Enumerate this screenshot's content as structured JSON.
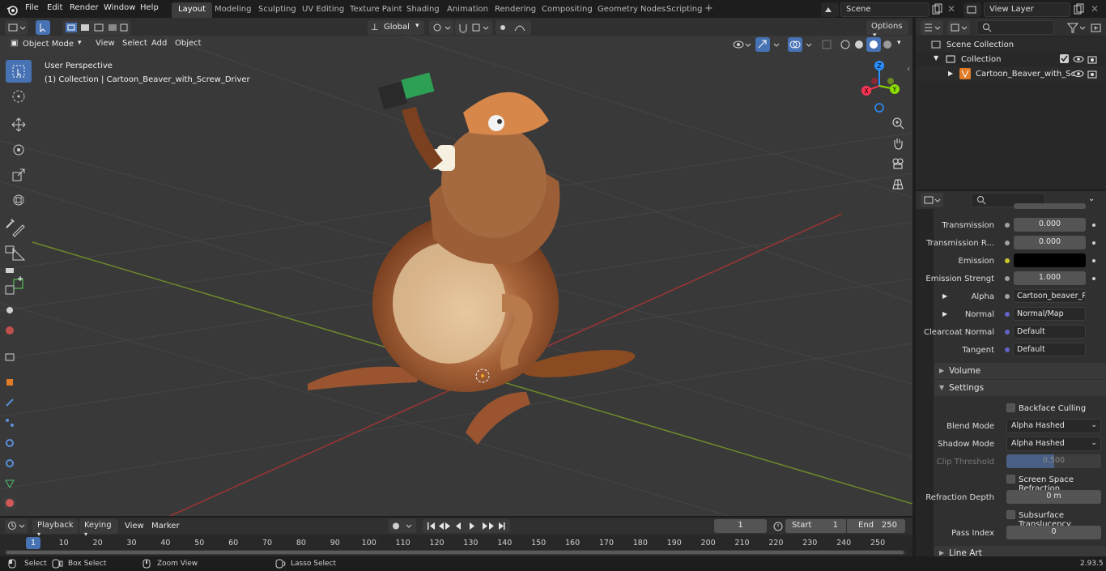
{
  "top_menu": [
    "File",
    "Edit",
    "Render",
    "Window",
    "Help"
  ],
  "workspace_tabs": [
    "Layout",
    "Modeling",
    "Sculpting",
    "UV Editing",
    "Texture Paint",
    "Shading",
    "Animation",
    "Rendering",
    "Compositing",
    "Geometry Nodes",
    "Scripting"
  ],
  "active_workspace": "Layout",
  "scene_name": "Scene",
  "view_layer": "View Layer",
  "viewport": {
    "mode": "Object Mode",
    "menus": [
      "View",
      "Select",
      "Add",
      "Object"
    ],
    "transform_orientation": "Global",
    "options_label": "Options",
    "overlay_title": "User Perspective",
    "overlay_subtitle": "(1) Collection | Cartoon_Beaver_with_Screw_Driver",
    "gizmo": {
      "x": "X",
      "y": "Y",
      "z": "Z"
    }
  },
  "outliner": {
    "scene_collection": "Scene Collection",
    "collection": "Collection",
    "object": "Cartoon_Beaver_with_Sc"
  },
  "properties": {
    "rows": [
      {
        "label": "Transmission",
        "value": "0.000",
        "kind": "slider"
      },
      {
        "label": "Transmission R...",
        "value": "0.000",
        "kind": "slider"
      },
      {
        "label": "Emission",
        "value": "",
        "kind": "color"
      },
      {
        "label": "Emission Strengt",
        "value": "1.000",
        "kind": "slider"
      },
      {
        "label": "Alpha",
        "value": "Cartoon_beaver_Re...",
        "kind": "link"
      },
      {
        "label": "Normal",
        "value": "Normal/Map",
        "kind": "link"
      },
      {
        "label": "Clearcoat Normal",
        "value": "Default",
        "kind": "link"
      },
      {
        "label": "Tangent",
        "value": "Default",
        "kind": "link"
      }
    ],
    "volume_label": "Volume",
    "settings_label": "Settings",
    "backface_culling": "Backface Culling",
    "blend_mode_label": "Blend Mode",
    "blend_mode": "Alpha Hashed",
    "shadow_mode_label": "Shadow Mode",
    "shadow_mode": "Alpha Hashed",
    "clip_threshold_label": "Clip Threshold",
    "clip_threshold": "0.500",
    "ssr_label": "Screen Space Refraction",
    "refraction_depth_label": "Refraction Depth",
    "refraction_depth": "0 m",
    "subsurface_label": "Subsurface Translucency",
    "pass_index_label": "Pass Index",
    "pass_index": "0",
    "line_art_label": "Line Art"
  },
  "timeline": {
    "menus": [
      "Playback",
      "Keying",
      "View",
      "Marker"
    ],
    "current_frame": "1",
    "start_label": "Start",
    "start": "1",
    "end_label": "End",
    "end": "250",
    "ticks": [
      "1",
      "10",
      "20",
      "30",
      "40",
      "50",
      "60",
      "70",
      "80",
      "90",
      "100",
      "110",
      "120",
      "130",
      "140",
      "150",
      "160",
      "170",
      "180",
      "190",
      "200",
      "210",
      "220",
      "230",
      "240",
      "250"
    ]
  },
  "statusbar": {
    "select": "Select",
    "box_select": "Box Select",
    "zoom_view": "Zoom View",
    "lasso_select": "Lasso Select",
    "version": "2.93.5"
  },
  "colors": {
    "accent": "#4772b3",
    "x_axis": "#ff3352",
    "y_axis": "#8bdc00",
    "z_axis": "#2890ff",
    "bg": "#393939"
  }
}
